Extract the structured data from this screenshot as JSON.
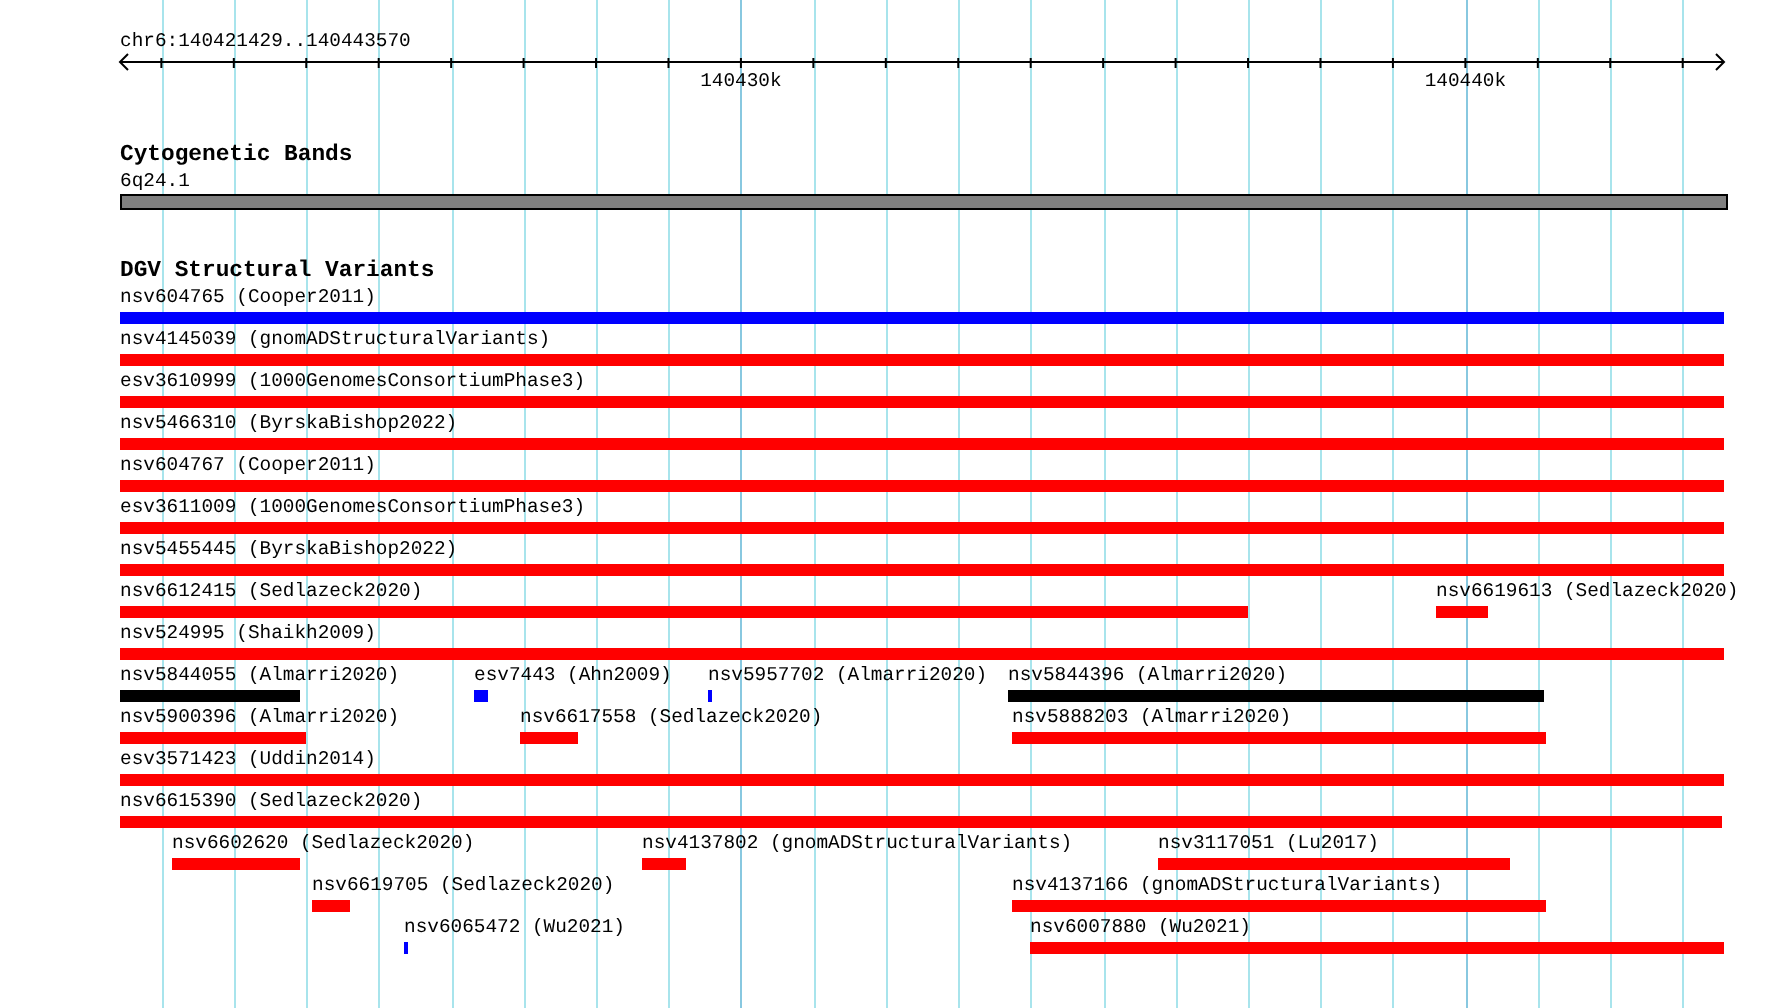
{
  "ruler": {
    "position": "chr6:140421429..140443570",
    "ticks": [
      {
        "label": "140430k"
      },
      {
        "label": "140440k"
      }
    ]
  },
  "tracks": [
    {
      "kind": "bands",
      "title": "Cytogenetic Bands",
      "rows": [
        [
          {
            "label": "6q24.1",
            "color": "#808080"
          }
        ]
      ]
    },
    {
      "kind": "variants",
      "title": "DGV Structural Variants",
      "rows": [
        [
          {
            "label": "nsv604765 (Cooper2011)",
            "color": "#0000ff"
          }
        ],
        [
          {
            "label": "nsv4145039 (gnomADStructuralVariants)",
            "color": "#ff0000"
          }
        ],
        [
          {
            "label": "esv3610999 (1000GenomesConsortiumPhase3)",
            "color": "#ff0000"
          }
        ],
        [
          {
            "label": "nsv5466310 (ByrskaBishop2022)",
            "color": "#ff0000"
          }
        ],
        [
          {
            "label": "nsv604767 (Cooper2011)",
            "color": "#ff0000"
          }
        ],
        [
          {
            "label": "esv3611009 (1000GenomesConsortiumPhase3)",
            "color": "#ff0000"
          }
        ],
        [
          {
            "label": "nsv5455445 (ByrskaBishop2022)",
            "color": "#ff0000"
          }
        ],
        [
          {
            "label": "nsv6612415 (Sedlazeck2020)",
            "color": "#ff0000"
          },
          {
            "label": "nsv6619613 (Sedlazeck2020)",
            "color": "#ff0000"
          }
        ],
        [
          {
            "label": "nsv524995 (Shaikh2009)",
            "color": "#ff0000"
          }
        ],
        [
          {
            "label": "nsv5844055 (Almarri2020)",
            "color": "#000000"
          },
          {
            "label": "esv7443 (Ahn2009)",
            "color": "#0000ff"
          },
          {
            "label": "nsv5957702 (Almarri2020)",
            "color": "#0000ff"
          },
          {
            "label": "nsv5844396 (Almarri2020)",
            "color": "#000000"
          }
        ],
        [
          {
            "label": "nsv5900396 (Almarri2020)",
            "color": "#ff0000"
          },
          {
            "label": "nsv6617558 (Sedlazeck2020)",
            "color": "#ff0000"
          },
          {
            "label": "nsv5888203 (Almarri2020)",
            "color": "#ff0000"
          }
        ],
        [
          {
            "label": "esv3571423 (Uddin2014)",
            "color": "#ff0000"
          }
        ],
        [
          {
            "label": "nsv6615390 (Sedlazeck2020)",
            "color": "#ff0000"
          }
        ],
        [
          {
            "label": "nsv6602620 (Sedlazeck2020)",
            "color": "#ff0000"
          },
          {
            "label": "nsv4137802 (gnomADStructuralVariants)",
            "color": "#ff0000"
          },
          {
            "label": "nsv3117051 (Lu2017)",
            "color": "#ff0000"
          }
        ],
        [
          {
            "label": "nsv6619705 (Sedlazeck2020)",
            "color": "#ff0000"
          },
          {
            "label": "nsv4137166 (gnomADStructuralVariants)",
            "color": "#ff0000"
          }
        ],
        [
          {
            "label": "nsv6065472 (Wu2021)",
            "color": "#0000ff"
          },
          {
            "label": "nsv6007880 (Wu2021)",
            "color": "#ff0000"
          }
        ]
      ]
    }
  ]
}
